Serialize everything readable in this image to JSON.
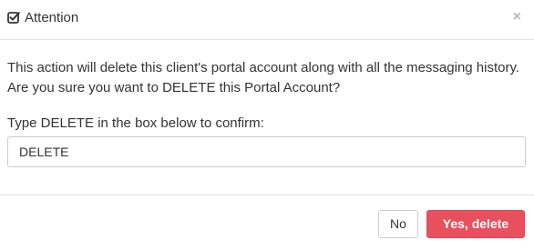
{
  "dialog": {
    "title": "Attention",
    "title_icon": "check-square-icon",
    "close_glyph": "×",
    "message": "This action will delete this client's portal account along with all the messaging history. Are you sure you want to DELETE this Portal Account?",
    "confirm_label": "Type DELETE in the box below to confirm:",
    "confirm_value": "DELETE",
    "buttons": {
      "no_label": "No",
      "yes_label": "Yes, delete"
    }
  },
  "colors": {
    "danger": "#e9505e",
    "border": "#cccccc",
    "text": "#333333"
  }
}
